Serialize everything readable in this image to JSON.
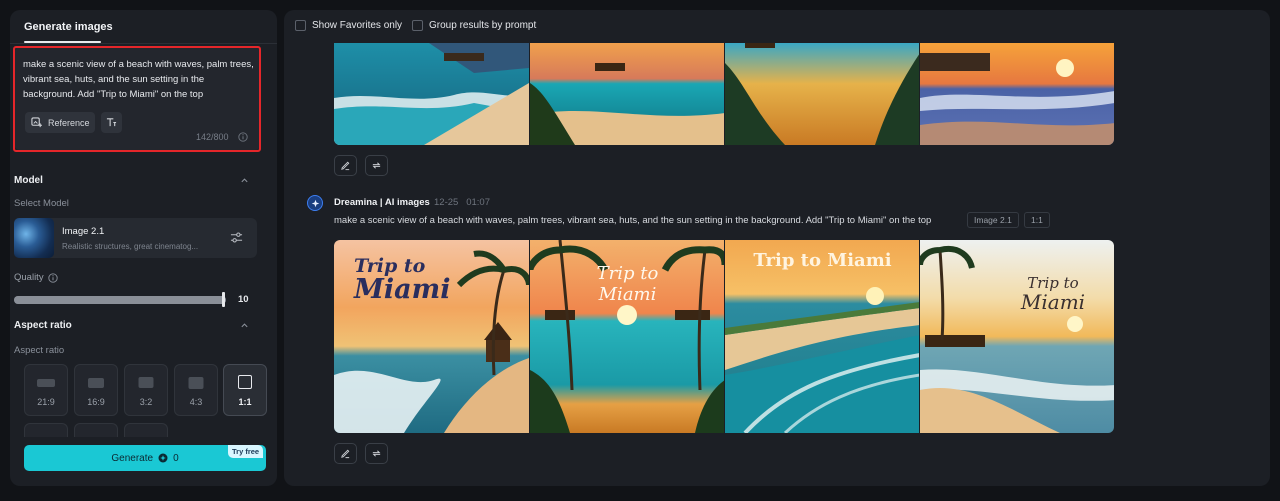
{
  "left_panel": {
    "tab_label": "Generate images",
    "prompt": "make a scenic view of a beach with waves, palm trees, vibrant sea, huts, and the sun setting in the background. Add \"Trip to Miami\" on the top",
    "reference_label": "Reference",
    "char_count": "142/800",
    "model_section": "Model",
    "select_model_label": "Select Model",
    "model_name": "Image 2.1",
    "model_desc": "Realistic structures, great cinematog...",
    "quality_label": "Quality",
    "quality_value": "10",
    "quality_fraction": 1.0,
    "aspect_section": "Aspect ratio",
    "aspect_label": "Aspect ratio",
    "ratios": [
      "21:9",
      "16:9",
      "3:2",
      "4:3",
      "1:1"
    ],
    "selected_ratio": "1:1",
    "generate_label": "Generate",
    "generate_cost": "0",
    "try_free_label": "Try free"
  },
  "main_panel": {
    "show_favorites_label": "Show Favorites only",
    "group_prompt_label": "Group results by prompt",
    "result": {
      "author": "Dreamina | AI images",
      "time": "12-25   01:07",
      "prompt": "make a scenic view of a beach with waves, palm trees, vibrant sea, huts, and the sun setting in the background. Add \"Trip to Miami\" on the top",
      "model_tag": "Image 2.1",
      "ratio_tag": "1:1"
    },
    "image_texts": [
      [
        "Trip to",
        "Miami"
      ],
      [
        "Trip to",
        "Miami"
      ],
      [
        "Trip to Miami"
      ],
      [
        "Trip to",
        "Miami"
      ]
    ]
  },
  "colors": {
    "generate_button": "#1ac8d4",
    "highlight_border": "#e5262a",
    "panel_bg": "#1c1f25",
    "page_bg": "#111317"
  },
  "icons": [
    "reference-icon",
    "text-style-icon",
    "info-icon",
    "chevron-up-icon",
    "settings-sliders-icon",
    "edit-icon",
    "regenerate-icon",
    "dreamina-logo-icon",
    "credit-icon"
  ]
}
